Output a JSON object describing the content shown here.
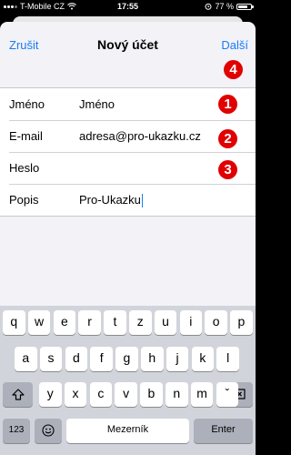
{
  "status_bar": {
    "carrier": "T-Mobile CZ",
    "time": "17:55",
    "battery": "77 %",
    "battery_level": 0.77
  },
  "nav": {
    "cancel": "Zrušit",
    "title": "Nový účet",
    "next": "Další"
  },
  "badges": [
    "1",
    "2",
    "3",
    "4"
  ],
  "form": {
    "rows": [
      {
        "label": "Jméno",
        "value": "Jméno"
      },
      {
        "label": "E-mail",
        "value": "adresa@pro-ukazku.cz"
      },
      {
        "label": "Heslo",
        "value": ""
      },
      {
        "label": "Popis",
        "value": "Pro-Ukazku"
      }
    ]
  },
  "keyboard": {
    "row1": [
      "q",
      "w",
      "e",
      "r",
      "t",
      "z",
      "u",
      "i",
      "o",
      "p"
    ],
    "row2": [
      "a",
      "s",
      "d",
      "f",
      "g",
      "h",
      "j",
      "k",
      "l"
    ],
    "row3": [
      "y",
      "x",
      "c",
      "v",
      "b",
      "n",
      "m",
      "ˇ"
    ],
    "numbers_key": "123",
    "space_key": "Mezerník",
    "return_key": "Enter",
    "icons": {
      "shift": "shift-icon",
      "delete": "delete-icon",
      "emoji": "emoji-icon"
    }
  }
}
